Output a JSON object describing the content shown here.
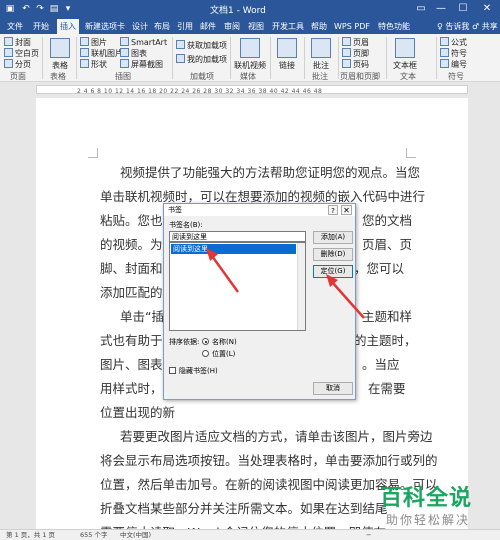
{
  "window": {
    "title": "文档1 - Word",
    "controls": {
      "ribbon_display": "▭",
      "minimize": "—",
      "maximize": "☐",
      "close": "✕"
    },
    "quick_access": [
      "save",
      "undo",
      "redo",
      "print-preview",
      "customize"
    ]
  },
  "tabs": [
    "文件",
    "开始",
    "插入",
    "新建选项卡",
    "设计",
    "布局",
    "引用",
    "邮件",
    "审阅",
    "视图",
    "开发工具",
    "帮助",
    "WPS PDF",
    "特色功能"
  ],
  "active_tab": "插入",
  "tell_me": "♀ 告诉我",
  "share": "♂ 共享",
  "ribbon": {
    "pages": {
      "cover": "封面",
      "blank": "空白页",
      "break": "分页",
      "group": "页面"
    },
    "table": {
      "label": "表格",
      "group": "表格"
    },
    "illustrations": {
      "pictures": "图片",
      "online_pictures": "联机图片",
      "shapes": "形状",
      "smartart": "SmartArt",
      "chart": "图表",
      "screenshot": "屏幕截图",
      "group": "插图"
    },
    "addins": {
      "get": "获取加载项",
      "my": "我的加载项",
      "group": "加载项"
    },
    "media": {
      "online_video": "联机视频",
      "group": "媒体"
    },
    "links": {
      "label": "链接"
    },
    "comments": {
      "label": "批注",
      "group": "批注"
    },
    "header_footer": {
      "header": "页眉",
      "footer": "页脚",
      "page_number": "页码",
      "group": "页眉和页脚"
    },
    "text": {
      "textbox": "文本框",
      "group": "文本"
    },
    "symbols": {
      "equation": "公式",
      "symbol": "符号",
      "number": "编号",
      "group": "符号"
    }
  },
  "ruler_numbers": "2 4 6 8 10 12 14 16 18 20 22 24 26 28 30 32 34 36 38 40 42 44 46 48",
  "document_lines": [
    "视频提供了功能强大的方法帮助您证明您的观点。当您",
    "单击联机视频时，可以在想要添加的视频的嵌入代码中进行",
    "粘贴。您也可",
    "的视频。为使",
    "脚、封面和文",
    "添加匹配的封",
    "单击“插",
    "式也有助于文",
    "图片、图表或",
    "用样式时，您",
    "位置出现的新",
    "若要更改图片适应文档的方式，请单击该图片，图片旁边",
    "将会显示布局选项按钮。当处理表格时，单击要添加行或列的",
    "位置，然后单击加号。在新的阅读视图中阅读更加容易。可以",
    "折叠文档某些部分并关注所需文本。如果在达到结尾",
    "需要停止读取，Word 会记住您的停止位置 - 即使在"
  ],
  "document_right_fragments": [
    {
      "line": 2,
      "text": "您的文档"
    },
    {
      "line": 3,
      "text": "页眉、页"
    },
    {
      "line": 4,
      "text": "，您可以"
    },
    {
      "line": 6,
      "text": "主题和样"
    },
    {
      "line": 7,
      "text": "的主题时，"
    },
    {
      "line": 8,
      "text": "。当应"
    },
    {
      "line": 9,
      "text": "在需要"
    }
  ],
  "dialog": {
    "title": "书签",
    "help": "?",
    "close": "✕",
    "name_label": "书签名(B):",
    "name_value": "阅读到这里",
    "list_items": [
      "阅读到这里"
    ],
    "buttons": {
      "add": "添加(A)",
      "delete": "删除(D)",
      "goto": "定位(G)",
      "cancel": "取消"
    },
    "sort_label": "排序依据:",
    "sort_options": {
      "name": "名称(N)",
      "location": "位置(L)"
    },
    "sort_selected": "name",
    "hidden_label": "隐藏书签(H)"
  },
  "status": {
    "page": "第 1 页，共 1 页",
    "words": "655 个字",
    "lang": "中文(中国)",
    "zoom_out": "−",
    "zoom_in": "+"
  },
  "watermark": {
    "title": "百科全说",
    "subtitle": "助你轻松解决"
  },
  "colors": {
    "titlebar": "#2b579a",
    "arrow": "#e23636",
    "selection": "#0b6bcf",
    "watermark": "#1aa560"
  }
}
